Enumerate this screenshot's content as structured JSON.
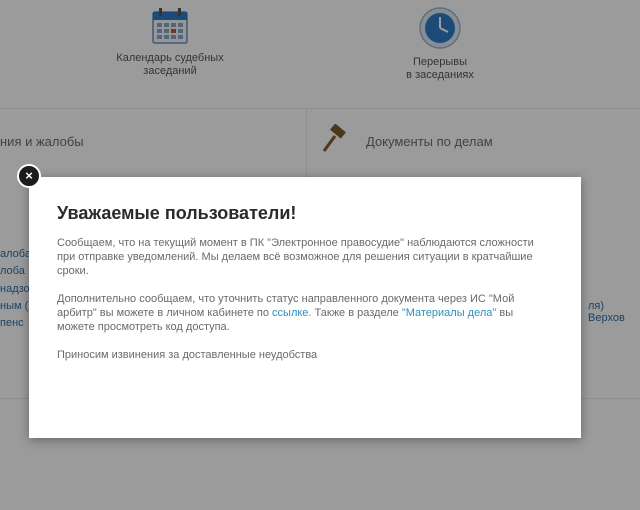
{
  "background": {
    "tiles": [
      {
        "label_line1": "Календарь судебных",
        "label_line2": "заседаний",
        "icon": "calendar-icon"
      },
      {
        "label_line1": "Перерывы",
        "label_line2": "в заседаниях",
        "icon": "clock-icon"
      }
    ],
    "sections": {
      "left_title": "ния и жалобы",
      "right_title": "Документы по делам",
      "right_icon": "gavel-icon"
    },
    "left_links": [
      "алоба",
      "лоба",
      "надзо",
      "ным (в",
      "пенс"
    ],
    "right_fragment": "ля) Верхов"
  },
  "modal": {
    "title": "Уважаемые пользователи!",
    "para1": "Сообщаем, что на текущий момент в ПК \"Электронное правосудие\" наблюдаются сложности при отправке уведомлений. Мы делаем всё возможное для решения ситуации в кратчайшие сроки.",
    "para2_part1": "Дополнительно сообщаем, что уточнить статус направленного документа через ИС \"Мой арбитр\" вы можете в личном кабинете по ",
    "para2_link1": "ссылке",
    "para2_part2": ". Также в разделе ",
    "para2_link2": "\"Материалы дела\"",
    "para2_part3": " вы можете просмотреть код доступа.",
    "para3": "Приносим извинения за доставленные неудобства",
    "close_label": "×",
    "close_icon": "close-icon"
  },
  "colors": {
    "link": "#2a8fbf",
    "overlay": "rgba(0,0,0,0.38)"
  }
}
